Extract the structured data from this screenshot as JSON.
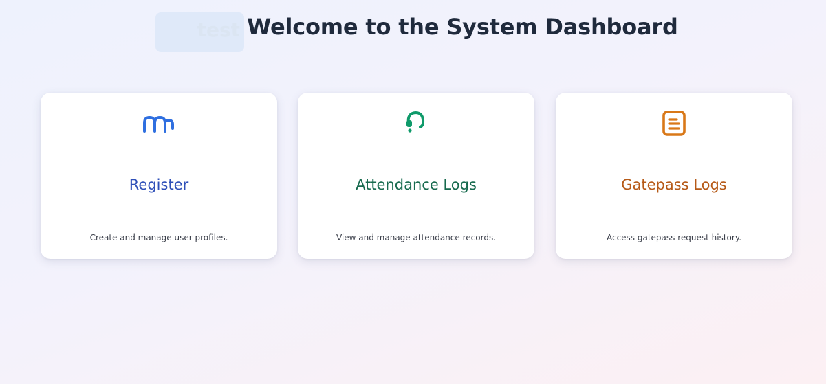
{
  "header": {
    "test_label": "test",
    "title": "Welcome to the System Dashboard"
  },
  "cards": [
    {
      "title": "Register",
      "description": "Create and manage user profiles.",
      "icon": "users-icon",
      "accent": "#2e4fb8",
      "icon_color": "#2f6fe0"
    },
    {
      "title": "Attendance Logs",
      "description": "View and manage attendance records.",
      "icon": "headset-icon",
      "accent": "#176a4e",
      "icon_color": "#0f9a6a"
    },
    {
      "title": "Gatepass Logs",
      "description": "Access gatepass request history.",
      "icon": "clipboard-icon",
      "accent": "#b65a18",
      "icon_color": "#d97818"
    }
  ]
}
